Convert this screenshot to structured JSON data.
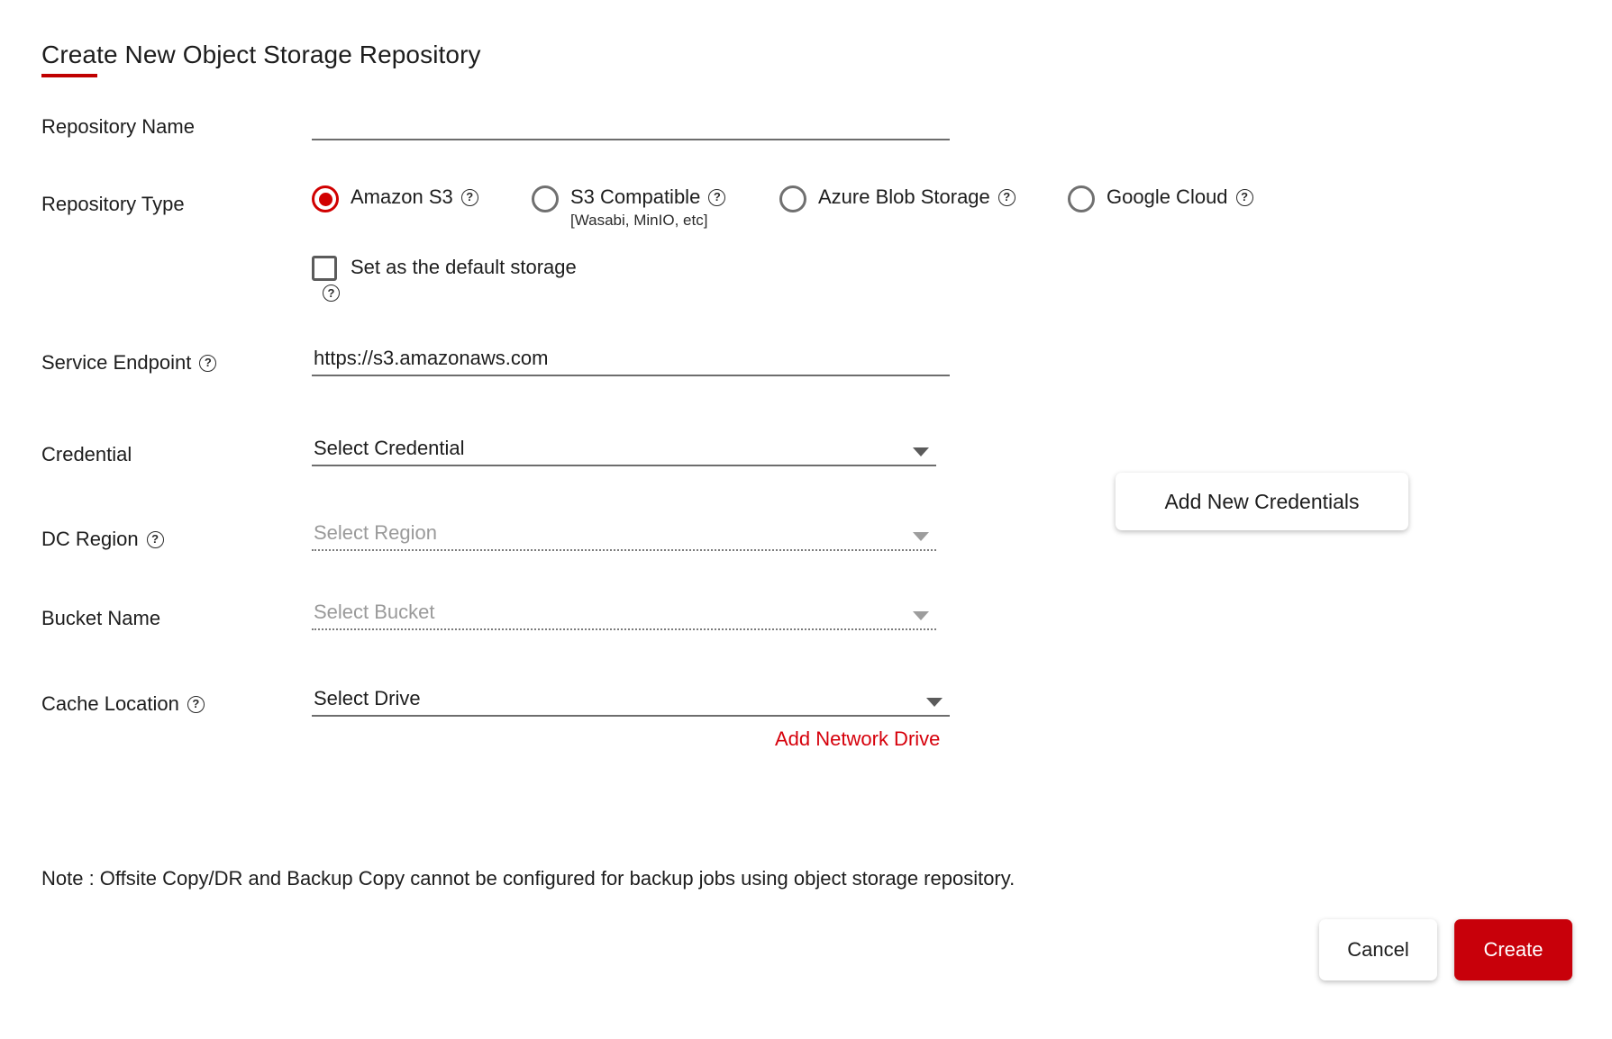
{
  "header": {
    "title": "Create New Object Storage Repository",
    "accent_color": "#c00000"
  },
  "form": {
    "repository_name": {
      "label": "Repository Name",
      "value": "",
      "placeholder": ""
    },
    "repository_type": {
      "label": "Repository Type",
      "selected": "Amazon S3",
      "options": [
        {
          "label": "Amazon S3",
          "sublabel": "",
          "selected": true,
          "help": "?"
        },
        {
          "label": "S3 Compatible",
          "sublabel": "[Wasabi, MinIO, etc]",
          "selected": false,
          "help": "?"
        },
        {
          "label": "Azure Blob Storage",
          "sublabel": "",
          "selected": false,
          "help": "?"
        },
        {
          "label": "Google Cloud",
          "sublabel": "",
          "selected": false,
          "help": "?"
        }
      ]
    },
    "default_storage": {
      "label": "Set as the default storage",
      "checked": false,
      "help": "?"
    },
    "service_endpoint": {
      "label": "Service Endpoint",
      "help": "?",
      "value": "https://s3.amazonaws.com"
    },
    "credential": {
      "label": "Credential",
      "value": "Select Credential",
      "disabled": false
    },
    "add_credentials_button": "Add New Credentials",
    "dc_region": {
      "label": "DC Region",
      "help": "?",
      "value": "Select Region",
      "disabled": true
    },
    "bucket_name": {
      "label": "Bucket Name",
      "value": "Select Bucket",
      "disabled": true
    },
    "cache_location": {
      "label": "Cache Location",
      "help": "?",
      "value": "Select Drive",
      "disabled": false
    },
    "add_network_drive_link": "Add Network Drive",
    "note": "Note : Offsite Copy/DR and Backup Copy cannot be configured for backup jobs using object storage repository."
  },
  "footer": {
    "cancel_label": "Cancel",
    "create_label": "Create",
    "create_color": "#c8000a"
  }
}
